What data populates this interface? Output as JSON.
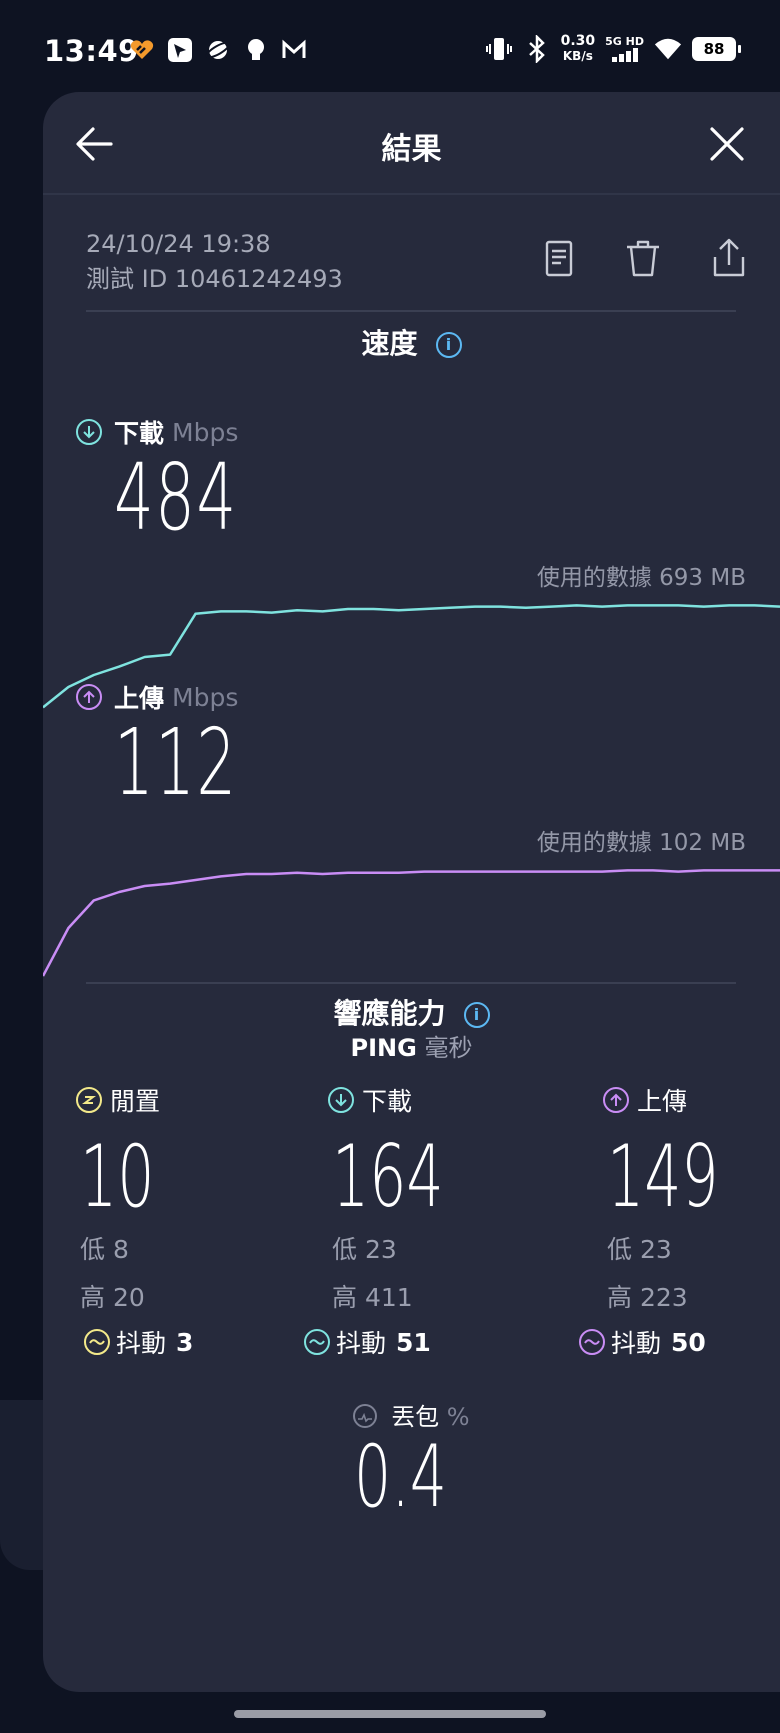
{
  "status_bar": {
    "time": "13:49",
    "net_speed_value": "0.30",
    "net_speed_unit": "KB/s",
    "network": "5G HD",
    "battery": "88"
  },
  "header": {
    "title": "結果"
  },
  "meta": {
    "date": "24/10/24 19:38",
    "test_id": "測試 ID 10461242493"
  },
  "speed_section": {
    "title": "速度",
    "download": {
      "label": "下載",
      "unit": "Mbps",
      "value": "484",
      "data_used": "使用的數據 693 MB"
    },
    "upload": {
      "label": "上傳",
      "unit": "Mbps",
      "value": "112",
      "data_used": "使用的數據 102 MB"
    }
  },
  "responsiveness_section": {
    "title": "響應能力",
    "ping_label": "PING",
    "ping_unit": "毫秒",
    "columns": [
      {
        "label": "閒置",
        "value": "10",
        "low": "低 8",
        "high": "高 20",
        "jitter_label": "抖動",
        "jitter_value": "3"
      },
      {
        "label": "下載",
        "value": "164",
        "low": "低 23",
        "high": "高 411",
        "jitter_label": "抖動",
        "jitter_value": "51"
      },
      {
        "label": "上傳",
        "value": "149",
        "low": "低 23",
        "high": "高 223",
        "jitter_label": "抖動",
        "jitter_value": "50"
      }
    ],
    "packet_loss": {
      "label": "丟包",
      "unit": "%",
      "value": "0.4"
    }
  },
  "colors": {
    "download": "#7fe3df",
    "upload": "#c98df5",
    "idle": "#f3e98a",
    "info": "#5cb8f2"
  },
  "chart_data": [
    {
      "type": "line",
      "series": [
        {
          "values": [
            0.08,
            0.25,
            0.35,
            0.42,
            0.5,
            0.52,
            0.86,
            0.88,
            0.88,
            0.87,
            0.89,
            0.88,
            0.9,
            0.9,
            0.89,
            0.9,
            0.91,
            0.92,
            0.92,
            0.91,
            0.92,
            0.93,
            0.92,
            0.93,
            0.93,
            0.93,
            0.92,
            0.93,
            0.93,
            0.92
          ]
        }
      ]
    },
    {
      "type": "line",
      "series": [
        {
          "values": [
            0.05,
            0.45,
            0.68,
            0.75,
            0.8,
            0.82,
            0.85,
            0.88,
            0.9,
            0.9,
            0.91,
            0.9,
            0.91,
            0.91,
            0.91,
            0.92,
            0.92,
            0.92,
            0.92,
            0.92,
            0.92,
            0.92,
            0.92,
            0.93,
            0.93,
            0.92,
            0.93,
            0.93,
            0.93,
            0.93
          ]
        }
      ]
    }
  ]
}
